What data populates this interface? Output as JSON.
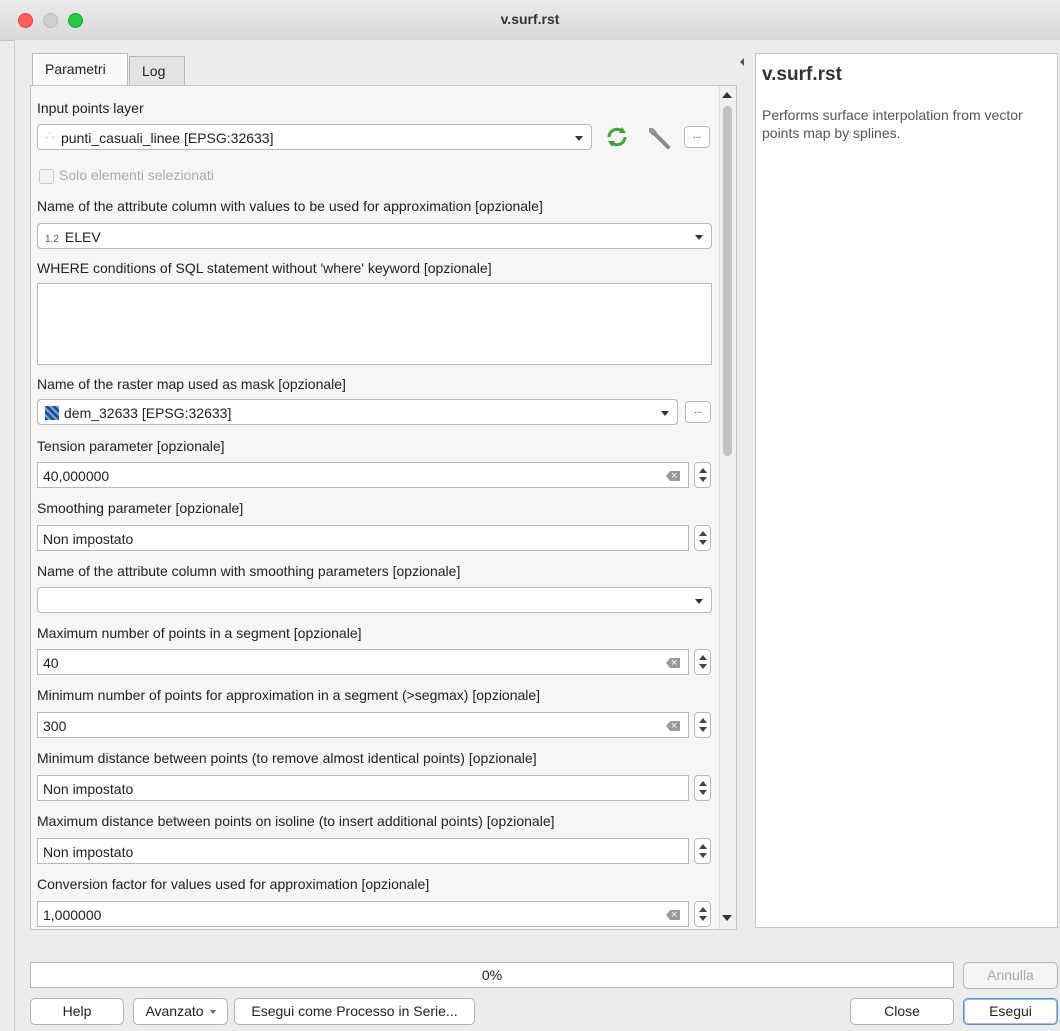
{
  "window": {
    "title": "v.surf.rst"
  },
  "tabs": [
    {
      "label": "Parametri"
    },
    {
      "label": "Log"
    }
  ],
  "params": {
    "input_layer": {
      "label": "Input points layer",
      "value": "punti_casuali_linee [EPSG:32633]"
    },
    "selected_only": {
      "label": "Solo elementi selezionati"
    },
    "zcolumn": {
      "label": "Name of the attribute column with values to be used for approximation [opzionale]",
      "value": "ELEV",
      "type_badge": "1.2"
    },
    "where": {
      "label": "WHERE conditions of SQL statement without 'where' keyword [opzionale]",
      "value": ""
    },
    "mask": {
      "label": "Name of the raster map used as mask [opzionale]",
      "value": "dem_32633 [EPSG:32633]"
    },
    "tension": {
      "label": "Tension parameter [opzionale]",
      "value": "40,000000"
    },
    "smooth": {
      "label": "Smoothing parameter [opzionale]",
      "value": "Non impostato"
    },
    "smooth_column": {
      "label": "Name of the attribute column with smoothing parameters [opzionale]",
      "value": ""
    },
    "segmax": {
      "label": "Maximum number of points in a segment [opzionale]",
      "value": "40"
    },
    "npmin": {
      "label": "Minimum number of points for approximation in a segment (>segmax) [opzionale]",
      "value": "300"
    },
    "dmin": {
      "label": "Minimum distance between points (to remove almost identical points) [opzionale]",
      "value": "Non impostato"
    },
    "dmax": {
      "label": "Maximum distance between points on isoline (to insert additional points) [opzionale]",
      "value": "Non impostato"
    },
    "zscale": {
      "label": "Conversion factor for values used for approximation [opzionale]",
      "value": "1,000000"
    }
  },
  "description": {
    "title": "v.surf.rst",
    "text": "Performs surface interpolation from vector points map by splines."
  },
  "progress": {
    "text": "0%",
    "value": 0
  },
  "buttons": {
    "cancel": "Annulla",
    "help": "Help",
    "advanced": "Avanzato",
    "batch": "Esegui come Processo in Serie...",
    "close": "Close",
    "run": "Esegui"
  },
  "icons": {
    "dots_label": "..."
  }
}
